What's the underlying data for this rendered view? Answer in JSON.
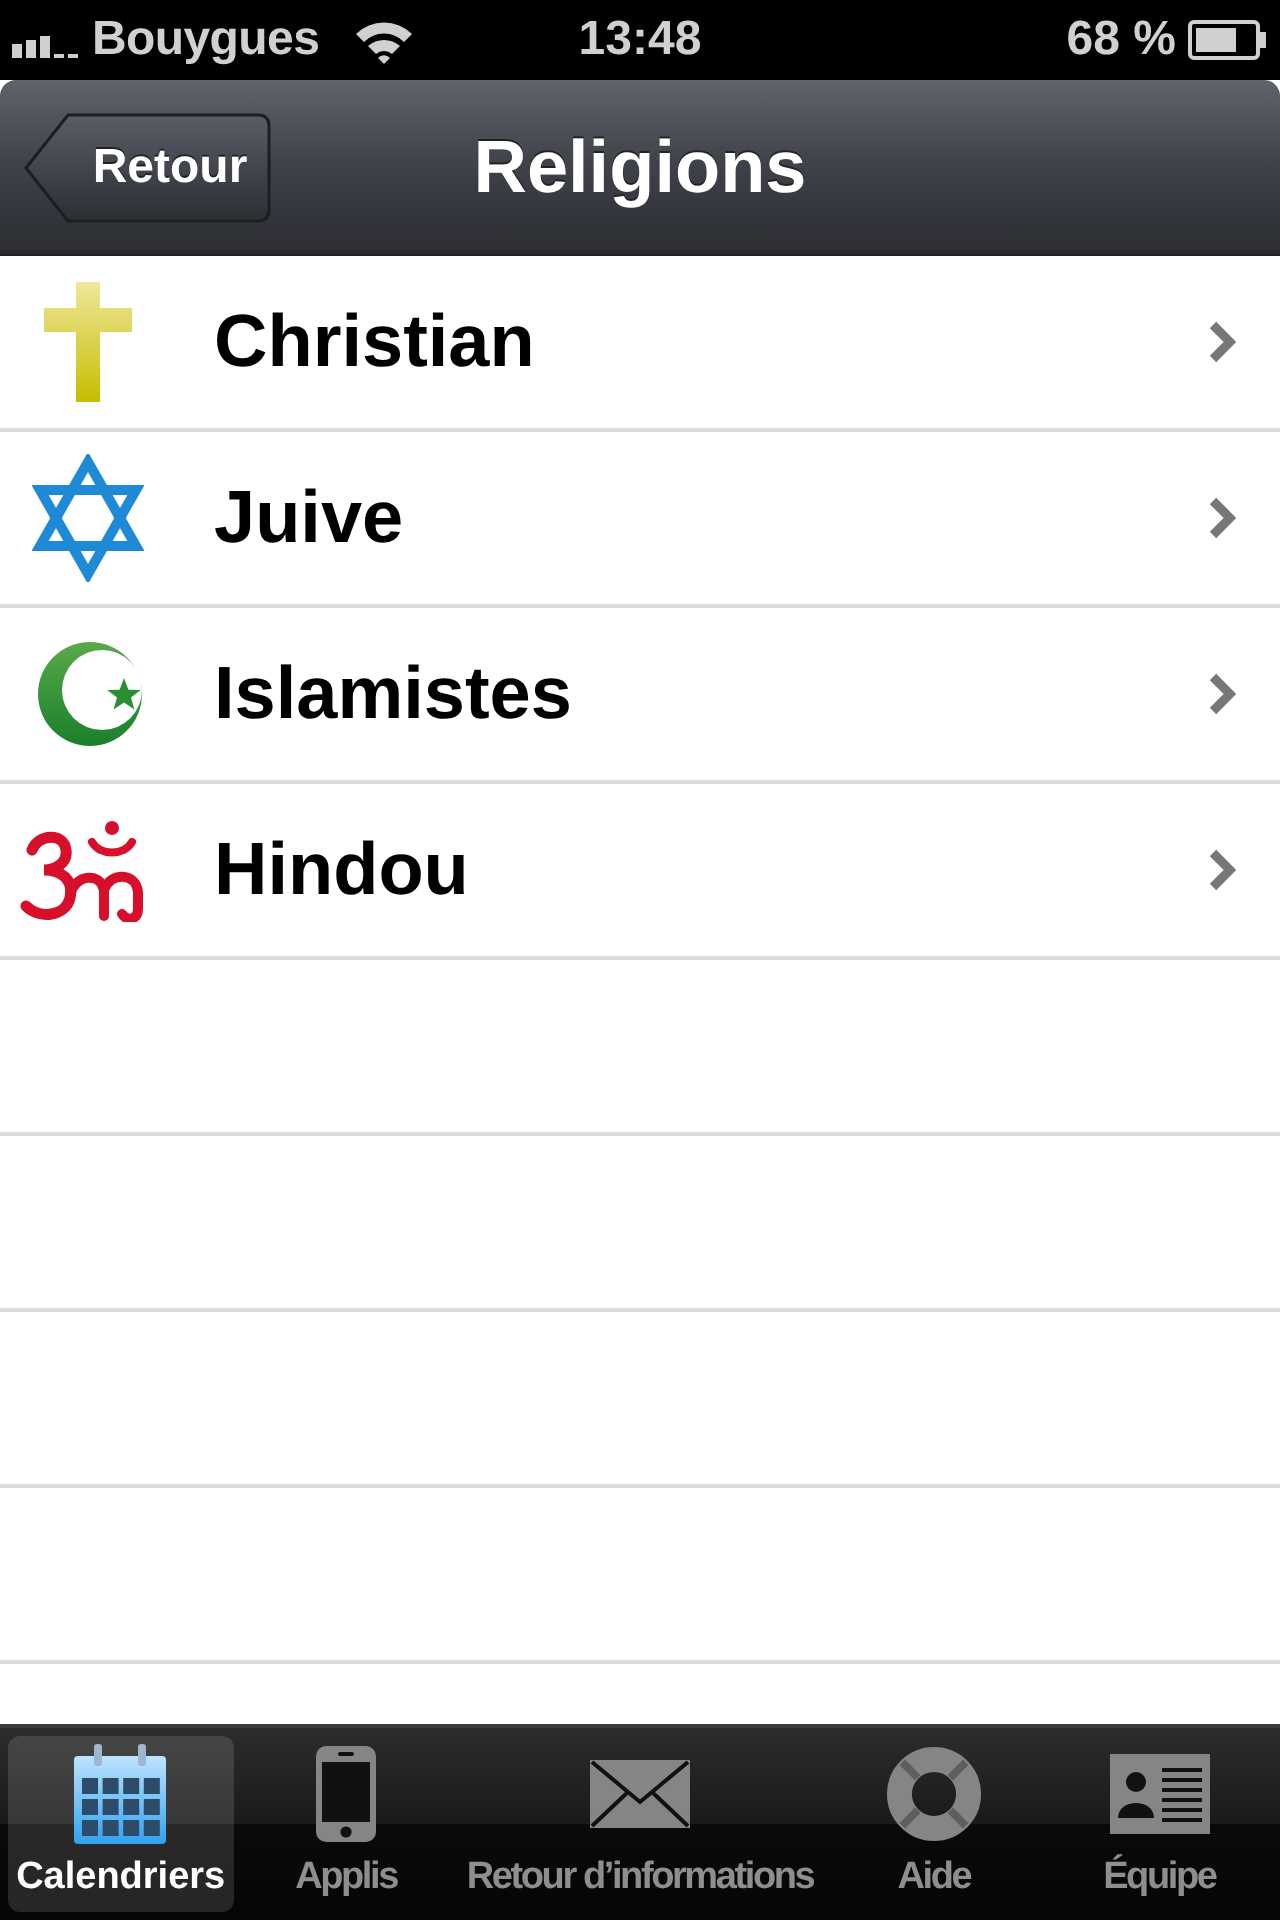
{
  "status_bar": {
    "carrier": "Bouygues",
    "time": "13:48",
    "battery": "68 %"
  },
  "nav_bar": {
    "back_button": "Retour",
    "title": "Religions"
  },
  "rows": [
    {
      "kind": "cross",
      "label": "Christian"
    },
    {
      "kind": "star",
      "label": "Juive"
    },
    {
      "kind": "crescent",
      "label": "Islamistes"
    },
    {
      "kind": "om",
      "label": "Hindou"
    }
  ],
  "tab_bar": [
    {
      "kind": "calendar",
      "label": "Calendriers",
      "selected": true
    },
    {
      "kind": "phone",
      "label": "Applis",
      "selected": false
    },
    {
      "kind": "envelope",
      "label": "Retour d’informations",
      "selected": false
    },
    {
      "kind": "lifebuoy",
      "label": "Aide",
      "selected": false
    },
    {
      "kind": "card",
      "label": "Équipe",
      "selected": false
    }
  ]
}
